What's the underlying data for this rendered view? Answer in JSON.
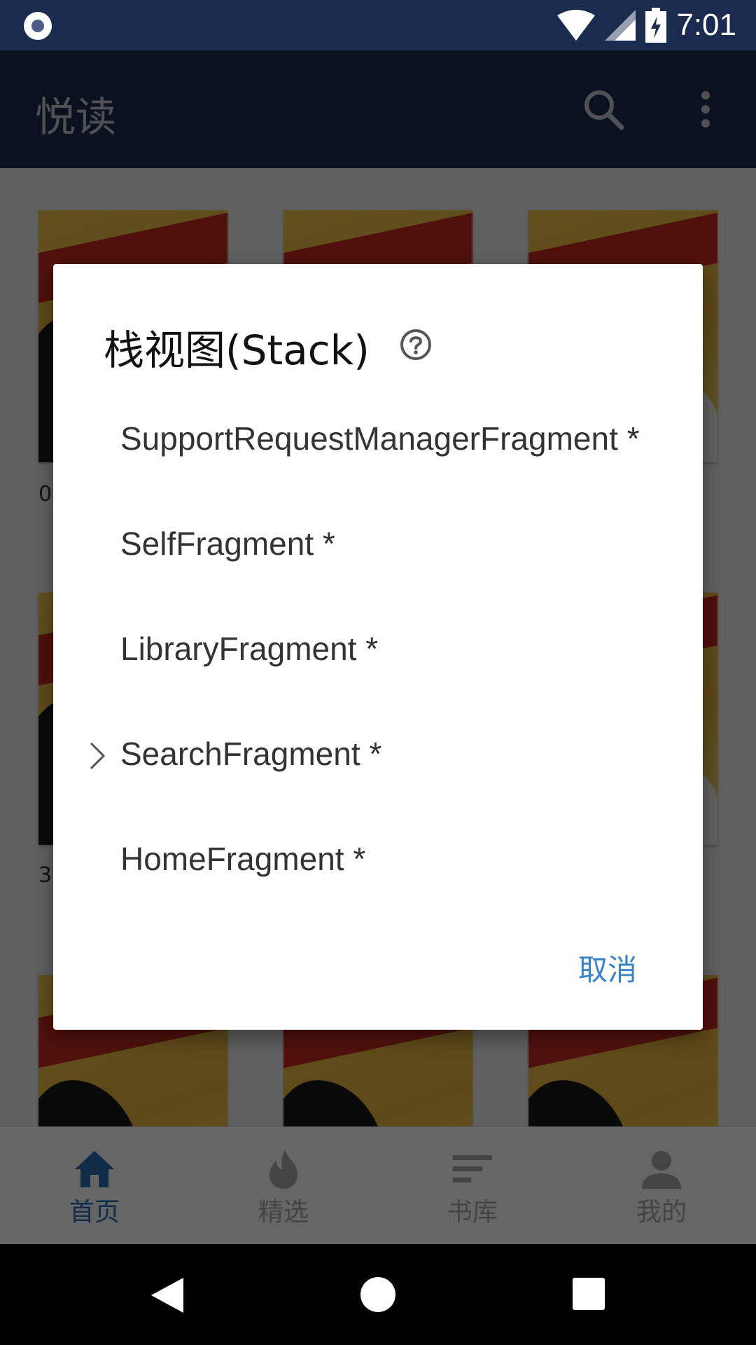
{
  "status_bar": {
    "time": "7:01"
  },
  "app_bar": {
    "title": "悦读"
  },
  "grid": {
    "captions": [
      "0",
      "3"
    ]
  },
  "bottom_nav": {
    "items": [
      {
        "label": "首页",
        "icon": "home-icon",
        "active": true
      },
      {
        "label": "精选",
        "icon": "flame-icon",
        "active": false
      },
      {
        "label": "书库",
        "icon": "library-icon",
        "active": false
      },
      {
        "label": "我的",
        "icon": "person-icon",
        "active": false
      }
    ]
  },
  "dialog": {
    "title": "栈视图(Stack)",
    "items": [
      {
        "label": "SupportRequestManagerFragment *"
      },
      {
        "label": "SelfFragment *"
      },
      {
        "label": "LibraryFragment *"
      },
      {
        "label": "SearchFragment *",
        "current": true
      },
      {
        "label": "HomeFragment *"
      }
    ],
    "cancel_label": "取消"
  },
  "colors": {
    "primary": "#1b2b4f",
    "accent": "#3a83c4",
    "nav_active": "#2c6fb3"
  }
}
